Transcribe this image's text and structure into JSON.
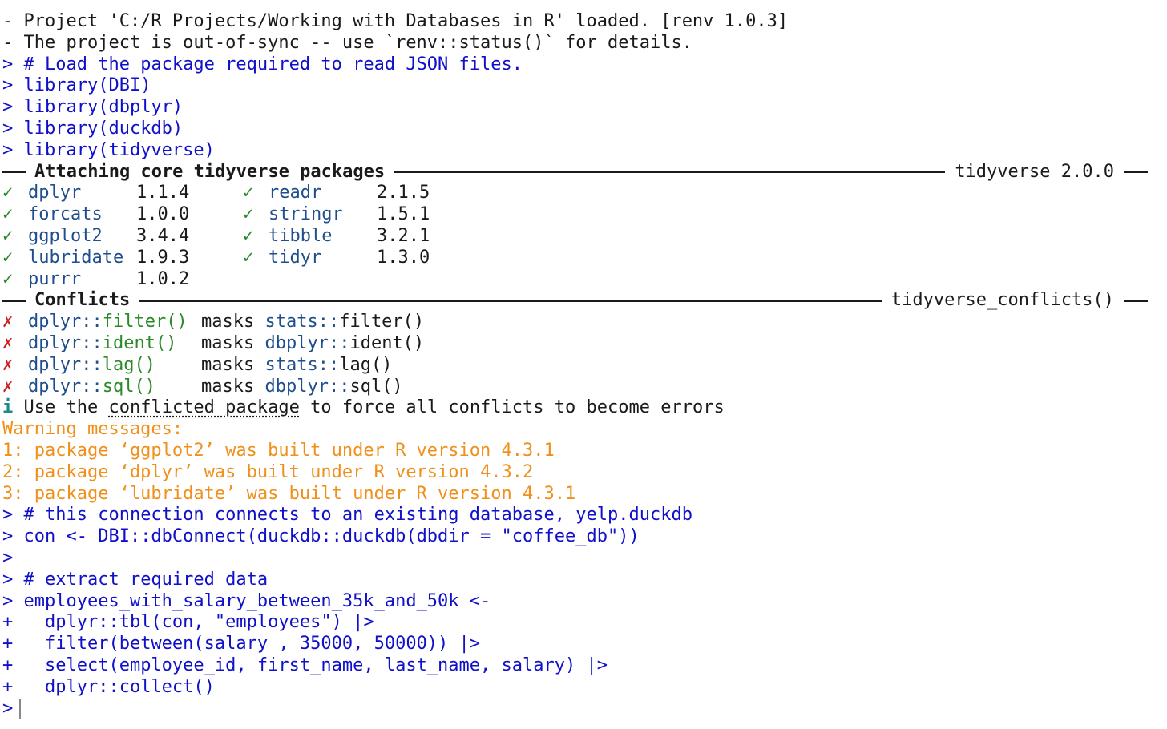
{
  "console": {
    "header": [
      "- Project 'C:/R Projects/Working with Databases in R' loaded. [renv 1.0.3]",
      "- The project is out-of-sync -- use `renv::status()` for details."
    ],
    "prompt": ">",
    "continuation": "+",
    "commands1": [
      " # Load the package required to read JSON files.",
      " library(DBI)",
      " library(dbplyr)",
      " library(duckdb)",
      " library(tidyverse)"
    ],
    "attach": {
      "title": "Attaching core tidyverse packages",
      "version_label": "tidyverse 2.0.0",
      "check": "✓",
      "rows": [
        {
          "a_name": "dplyr",
          "a_ver": "1.1.4",
          "b_name": "readr",
          "b_ver": "2.1.5"
        },
        {
          "a_name": "forcats",
          "a_ver": "1.0.0",
          "b_name": "stringr",
          "b_ver": "1.5.1"
        },
        {
          "a_name": "ggplot2",
          "a_ver": "3.4.4",
          "b_name": "tibble",
          "b_ver": "3.2.1"
        },
        {
          "a_name": "lubridate",
          "a_ver": "1.9.3",
          "b_name": "tidyr",
          "b_ver": "1.3.0"
        },
        {
          "a_name": "purrr",
          "a_ver": "1.0.2"
        }
      ]
    },
    "conflicts": {
      "title": "Conflicts",
      "fn_label": "tidyverse_conflicts()",
      "cross": "✗",
      "masks": "masks",
      "rows": [
        {
          "pkg": "dplyr::",
          "fn": "filter()",
          "mpkg": "stats::",
          "mfn": "filter()"
        },
        {
          "pkg": "dplyr::",
          "fn": "ident()",
          "mpkg": "dbplyr::",
          "mfn": "ident()"
        },
        {
          "pkg": "dplyr::",
          "fn": "lag()",
          "mpkg": "stats::",
          "mfn": "lag()"
        },
        {
          "pkg": "dplyr::",
          "fn": "sql()",
          "mpkg": "dbplyr::",
          "mfn": "sql()"
        }
      ],
      "info_icon": "i",
      "info_pre": " Use the ",
      "info_link": "conflicted package",
      "info_post": " to force all conflicts to become errors"
    },
    "warnings": [
      "Warning messages:",
      "1: package ‘ggplot2’ was built under R version 4.3.1",
      "2: package ‘dplyr’ was built under R version 4.3.2",
      "3: package ‘lubridate’ was built under R version 4.3.1"
    ],
    "commands2": [
      " # this connection connects to an existing database, yelp.duckdb",
      " con <- DBI::dbConnect(duckdb::duckdb(dbdir = \"coffee_db\"))",
      "",
      " # extract required data",
      " employees_with_salary_between_35k_and_50k <-"
    ],
    "continuations": [
      "   dplyr::tbl(con, \"employees\") |>",
      "   filter(between(salary , 35000, 50000)) |>",
      "   select(employee_id, first_name, last_name, salary) |>",
      "   dplyr::collect()"
    ]
  }
}
